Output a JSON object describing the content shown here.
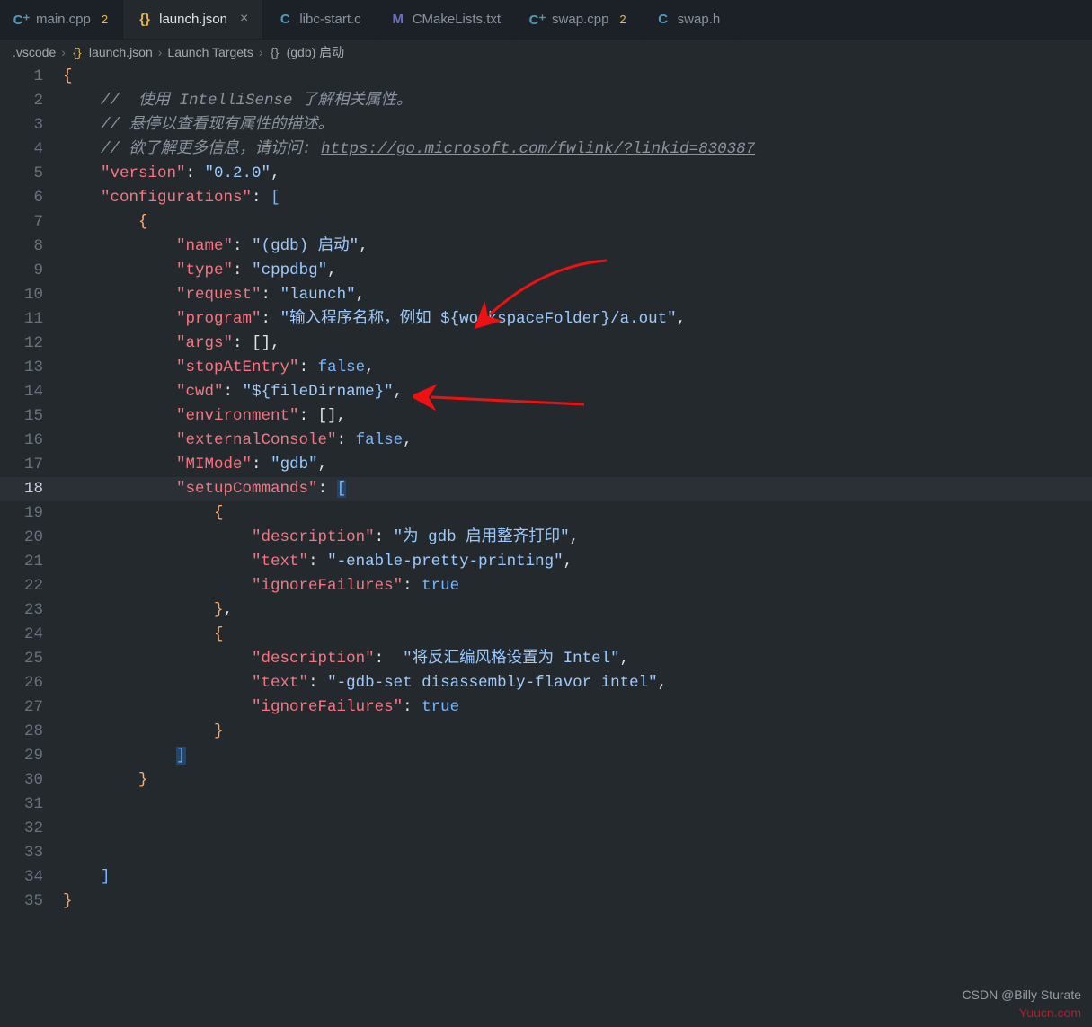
{
  "tabs": [
    {
      "icon": "C⁺",
      "iconClass": "icon-cpp",
      "label": "main.cpp",
      "badge": "2",
      "active": false
    },
    {
      "icon": "{}",
      "iconClass": "icon-json",
      "label": "launch.json",
      "badge": "",
      "active": true,
      "close": true
    },
    {
      "icon": "C",
      "iconClass": "icon-c",
      "label": "libc-start.c",
      "badge": "",
      "active": false
    },
    {
      "icon": "M",
      "iconClass": "icon-m",
      "label": "CMakeLists.txt",
      "badge": "",
      "active": false
    },
    {
      "icon": "C⁺",
      "iconClass": "icon-cpp",
      "label": "swap.cpp",
      "badge": "2",
      "active": false
    },
    {
      "icon": "C",
      "iconClass": "icon-c",
      "label": "swap.h",
      "badge": "",
      "active": false
    }
  ],
  "breadcrumb": {
    "part0": ".vscode",
    "part1": "launch.json",
    "part2": "Launch Targets",
    "part3": "(gdb) 启动"
  },
  "lines": 35,
  "activeLine": 18,
  "code": {
    "c1": "//  使用 IntelliSense 了解相关属性。",
    "c2": "// 悬停以查看现有属性的描述。",
    "c3a": "// 欲了解更多信息，请访问: ",
    "c3b": "https://go.microsoft.com/fwlink/?linkid=830387",
    "k_version": "\"version\"",
    "v_version": "\"0.2.0\"",
    "k_configs": "\"configurations\"",
    "k_name": "\"name\"",
    "v_name": "\"(gdb) 启动\"",
    "k_type": "\"type\"",
    "v_type": "\"cppdbg\"",
    "k_request": "\"request\"",
    "v_request": "\"launch\"",
    "k_program": "\"program\"",
    "v_program": "\"输入程序名称，例如 ${workspaceFolder}/a.out\"",
    "k_args": "\"args\"",
    "k_stop": "\"stopAtEntry\"",
    "v_false": "false",
    "k_cwd": "\"cwd\"",
    "v_cwd": "\"${fileDirname}\"",
    "k_env": "\"environment\"",
    "k_ext": "\"externalConsole\"",
    "k_mi": "\"MIMode\"",
    "v_mi": "\"gdb\"",
    "k_setup": "\"setupCommands\"",
    "k_desc": "\"description\"",
    "v_desc1": "\"为 gdb 启用整齐打印\"",
    "k_text": "\"text\"",
    "v_text1": "\"-enable-pretty-printing\"",
    "k_ign": "\"ignoreFailures\"",
    "v_true": "true",
    "v_desc2": "\"将反汇编风格设置为 Intel\"",
    "v_text2": "\"-gdb-set disassembly-flavor intel\""
  },
  "watermark1": "CSDN @Billy Sturate",
  "watermark2": "Yuucn.com"
}
